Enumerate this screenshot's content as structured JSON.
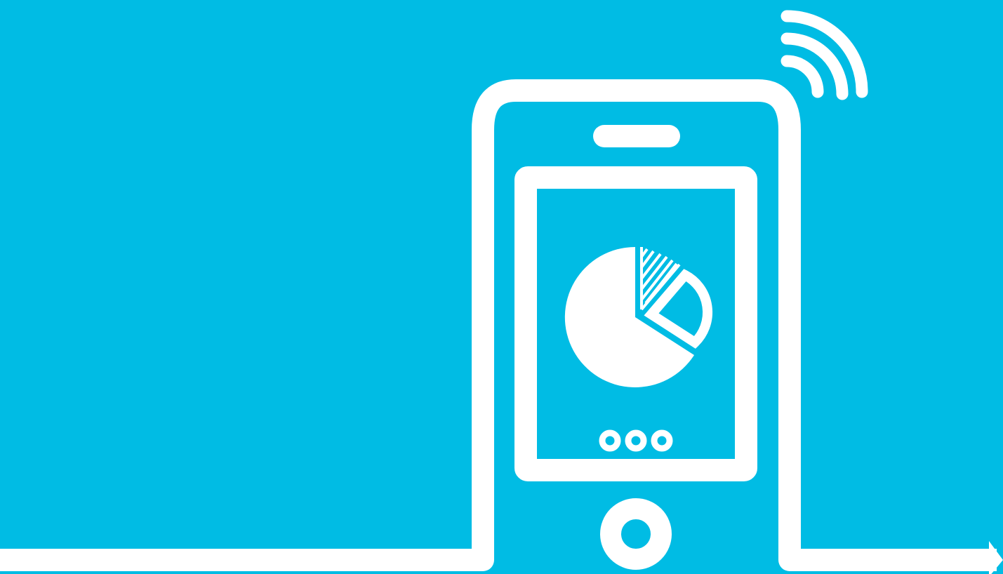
{
  "illustration": {
    "subject": "smartphone-with-pie-chart",
    "colors": {
      "background": "#00bce4",
      "line": "#ffffff"
    },
    "icons": [
      "wifi-signal-icon",
      "phone-outline-icon",
      "speaker-slot-icon",
      "pie-chart-icon",
      "pagination-dots-icon",
      "home-button-icon",
      "baseline-arrow-icon"
    ],
    "pagination": {
      "total_dots": 3
    }
  }
}
